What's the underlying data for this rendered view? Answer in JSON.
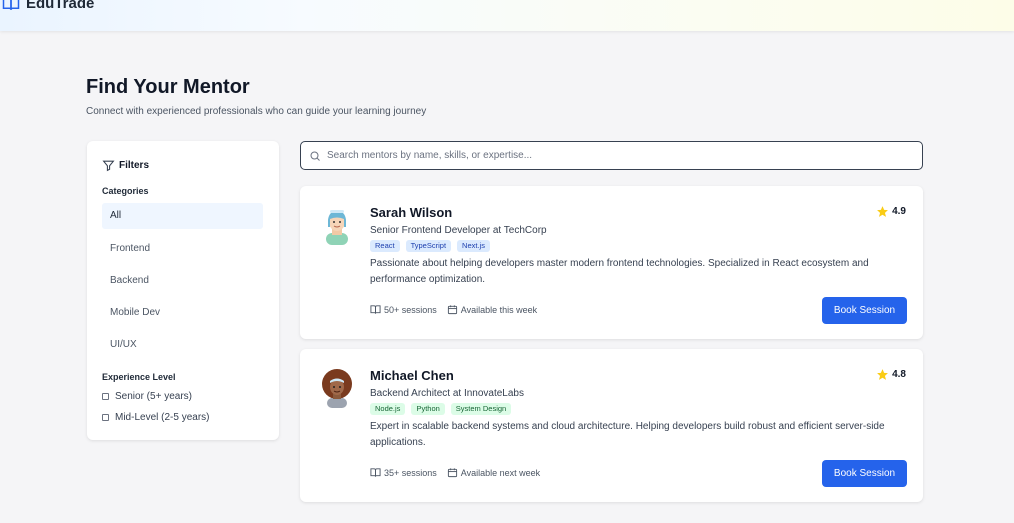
{
  "header": {
    "brand": "EduTrade"
  },
  "page": {
    "title": "Find Your Mentor",
    "subtitle": "Connect with experienced professionals who can guide your learning journey"
  },
  "filters": {
    "title": "Filters",
    "categories_label": "Categories",
    "categories": [
      "All",
      "Frontend",
      "Backend",
      "Mobile Dev",
      "UI/UX"
    ],
    "active_category": "All",
    "experience_label": "Experience Level",
    "experience": [
      "Senior (5+ years)",
      "Mid-Level (2-5 years)"
    ]
  },
  "search": {
    "placeholder": "Search mentors by name, skills, or expertise..."
  },
  "mentors": [
    {
      "name": "Sarah Wilson",
      "role": "Senior Frontend Developer at TechCorp",
      "tags": [
        "React",
        "TypeScript",
        "Next.js"
      ],
      "tag_color": "blue",
      "description": "Passionate about helping developers master modern frontend technologies. Specialized in React ecosystem and performance optimization.",
      "sessions": "50+ sessions",
      "availability": "Available this week",
      "rating": "4.9",
      "button": "Book Session"
    },
    {
      "name": "Michael Chen",
      "role": "Backend Architect at InnovateLabs",
      "tags": [
        "Node.js",
        "Python",
        "System Design"
      ],
      "tag_color": "green",
      "description": "Expert in scalable backend systems and cloud architecture. Helping developers build robust and efficient server-side applications.",
      "sessions": "35+ sessions",
      "availability": "Available next week",
      "rating": "4.8",
      "button": "Book Session"
    }
  ],
  "colors": {
    "accent": "#2563eb",
    "star": "#facc15",
    "tag_blue_bg": "#dbeafe",
    "tag_green_bg": "#dcfce7"
  }
}
